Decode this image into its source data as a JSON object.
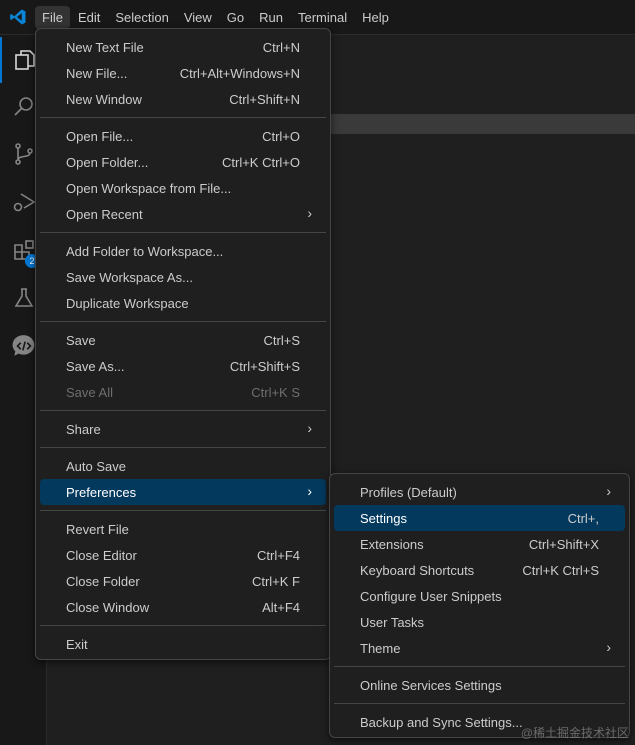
{
  "menubar": [
    "File",
    "Edit",
    "Selection",
    "View",
    "Go",
    "Run",
    "Terminal",
    "Help"
  ],
  "activity": {
    "extensions_badge": "2"
  },
  "file_menu": [
    [
      {
        "label": "New Text File",
        "kb": "Ctrl+N"
      },
      {
        "label": "New File...",
        "kb": "Ctrl+Alt+Windows+N"
      },
      {
        "label": "New Window",
        "kb": "Ctrl+Shift+N"
      }
    ],
    [
      {
        "label": "Open File...",
        "kb": "Ctrl+O"
      },
      {
        "label": "Open Folder...",
        "kb": "Ctrl+K Ctrl+O"
      },
      {
        "label": "Open Workspace from File...",
        "kb": ""
      },
      {
        "label": "Open Recent",
        "kb": "",
        "sub": true
      }
    ],
    [
      {
        "label": "Add Folder to Workspace...",
        "kb": ""
      },
      {
        "label": "Save Workspace As...",
        "kb": ""
      },
      {
        "label": "Duplicate Workspace",
        "kb": ""
      }
    ],
    [
      {
        "label": "Save",
        "kb": "Ctrl+S"
      },
      {
        "label": "Save As...",
        "kb": "Ctrl+Shift+S"
      },
      {
        "label": "Save All",
        "kb": "Ctrl+K S",
        "disabled": true
      }
    ],
    [
      {
        "label": "Share",
        "kb": "",
        "sub": true
      }
    ],
    [
      {
        "label": "Auto Save",
        "kb": ""
      },
      {
        "label": "Preferences",
        "kb": "",
        "sub": true,
        "highlight": true
      }
    ],
    [
      {
        "label": "Revert File",
        "kb": ""
      },
      {
        "label": "Close Editor",
        "kb": "Ctrl+F4"
      },
      {
        "label": "Close Folder",
        "kb": "Ctrl+K F"
      },
      {
        "label": "Close Window",
        "kb": "Alt+F4"
      }
    ],
    [
      {
        "label": "Exit",
        "kb": ""
      }
    ]
  ],
  "preferences_menu": [
    [
      {
        "label": "Profiles (Default)",
        "kb": "",
        "sub": true
      },
      {
        "label": "Settings",
        "kb": "Ctrl+,",
        "highlight": true
      },
      {
        "label": "Extensions",
        "kb": "Ctrl+Shift+X"
      },
      {
        "label": "Keyboard Shortcuts",
        "kb": "Ctrl+K Ctrl+S"
      },
      {
        "label": "Configure User Snippets",
        "kb": ""
      },
      {
        "label": "User Tasks",
        "kb": ""
      },
      {
        "label": "Theme",
        "kb": "",
        "sub": true
      }
    ],
    [
      {
        "label": "Online Services Settings",
        "kb": ""
      }
    ],
    [
      {
        "label": "Backup and Sync Settings...",
        "kb": ""
      }
    ]
  ],
  "watermark": "@稀土掘金技术社区"
}
